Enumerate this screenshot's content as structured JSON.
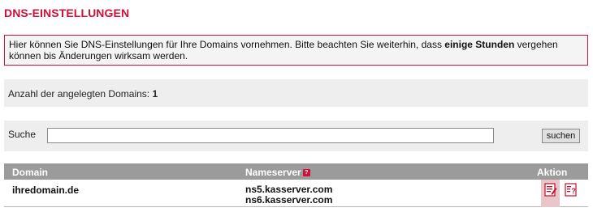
{
  "page": {
    "title": "DNS-EINSTELLUNGEN"
  },
  "notice": {
    "text_before": "Hier können Sie DNS-Einstellungen für Ihre Domains vornehmen. Bitte beachten Sie weiterhin, dass ",
    "text_bold": "einige Stunden",
    "text_after": " vergehen können bis Änderungen wirksam werden."
  },
  "count": {
    "label": "Anzahl der angelegten Domains: ",
    "value": "1"
  },
  "search": {
    "label": "Suche",
    "value": "",
    "button_label": "suchen"
  },
  "table": {
    "columns": {
      "domain": "Domain",
      "nameserver": "Nameserver",
      "action": "Aktion"
    },
    "rows": [
      {
        "domain": "ihredomain.de",
        "nameservers": [
          "ns5.kasserver.com",
          "ns6.kasserver.com"
        ],
        "actions": [
          "edit-dns-icon",
          "info-icon"
        ]
      }
    ]
  },
  "colors": {
    "accent": "#d0103a",
    "header_bg": "#9b9b9b",
    "panel_bg": "#eeeeee",
    "action_highlight": "#e8c6c9"
  }
}
